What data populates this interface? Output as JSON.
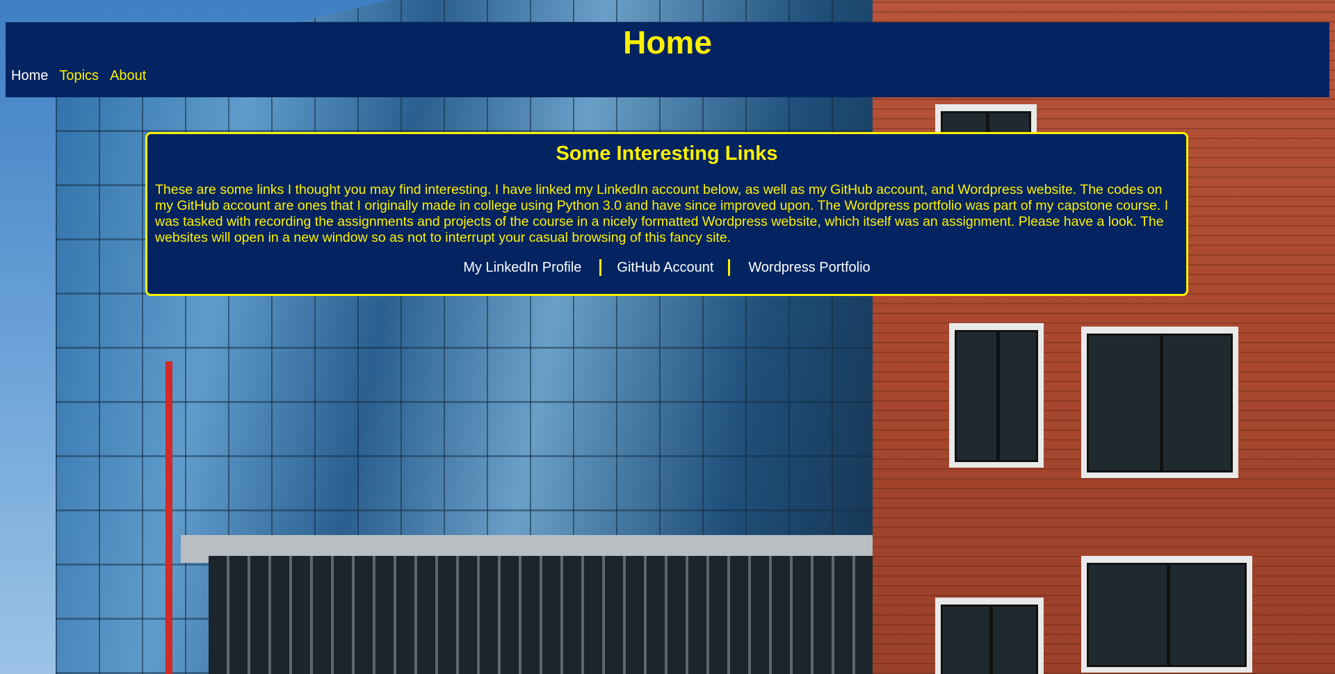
{
  "header": {
    "title": "Home",
    "nav": [
      {
        "label": "Home"
      },
      {
        "label": "Topics"
      },
      {
        "label": "About"
      }
    ]
  },
  "panel": {
    "heading": "Some Interesting Links",
    "body": "These are some links I thought you may find interesting. I have linked my LinkedIn account below, as well as my GitHub account, and Wordpress website. The codes on my GitHub account are ones that I originally made in college using Python 3.0 and have since improved upon. The Wordpress portfolio was part of my capstone course. I was tasked with recording the assignments and projects of the course in a nicely formatted Wordpress website, which itself was an assignment. Please have a look. The websites will open in a new window so as not to interrupt your casual browsing of this fancy site.",
    "links": [
      {
        "label": "My LinkedIn Profile"
      },
      {
        "label": "GitHub Account"
      },
      {
        "label": "Wordpress Portfolio"
      }
    ]
  },
  "colors": {
    "navy": "#032461",
    "accent_yellow": "#fff100",
    "link_white": "#ffffff"
  }
}
